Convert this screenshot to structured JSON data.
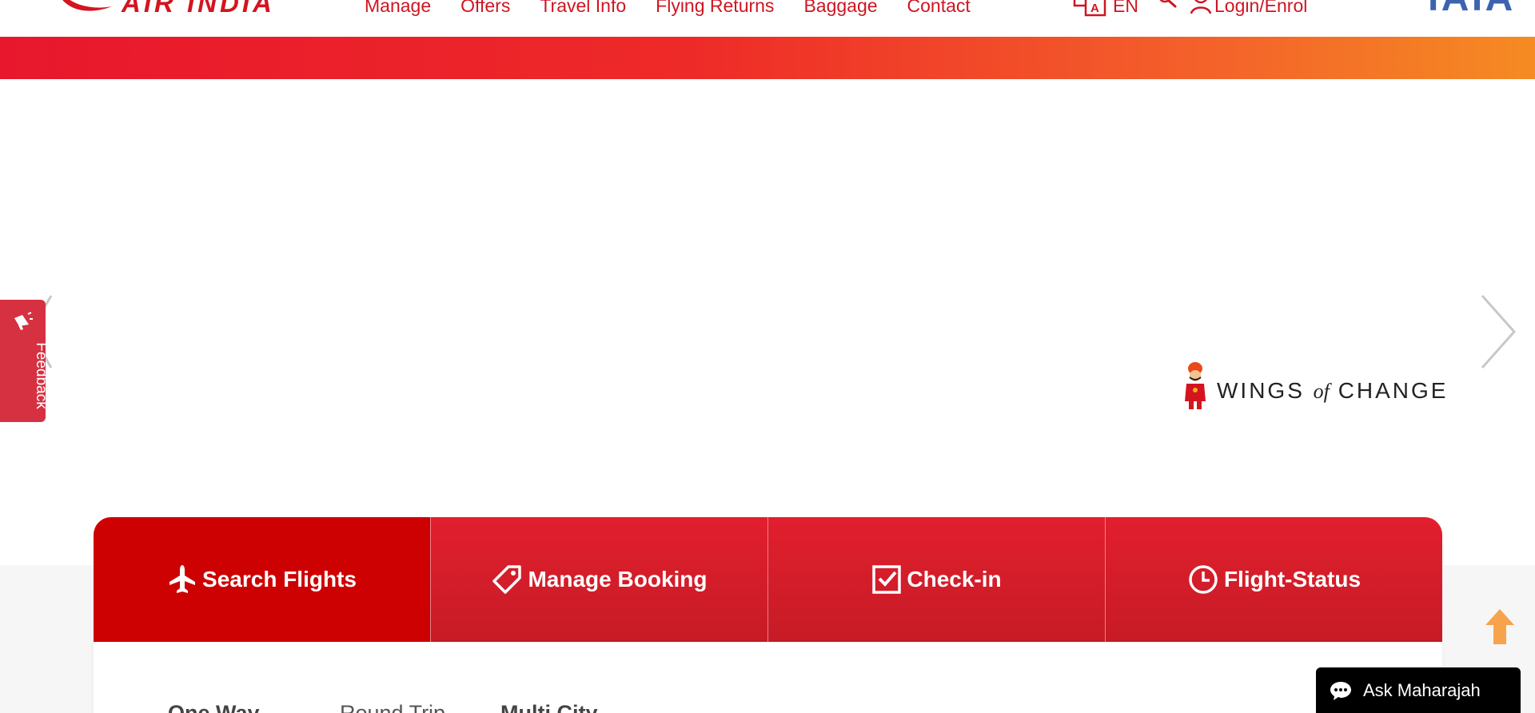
{
  "header": {
    "logo_text": "AIR INDIA",
    "nav": [
      "Manage",
      "Offers",
      "Travel Info",
      "Flying Returns",
      "Baggage",
      "Contact"
    ],
    "language": "EN",
    "login_label": "Login/Enrol",
    "partner_logo_text": "TATA"
  },
  "hero": {
    "campaign_words": [
      "WINGS",
      "of",
      "CHANGE"
    ]
  },
  "feedback": {
    "label": "Feedback"
  },
  "tabs": [
    {
      "label": "Search Flights",
      "icon": "airplane-icon",
      "active": true
    },
    {
      "label": "Manage Booking",
      "icon": "tag-icon",
      "active": false
    },
    {
      "label": "Check-in",
      "icon": "checkbox-icon",
      "active": false
    },
    {
      "label": "Flight-Status",
      "icon": "clock-icon",
      "active": false
    }
  ],
  "trip_types": [
    "One Way",
    "Round Trip",
    "Multi City"
  ],
  "chat": {
    "label": "Ask Maharajah"
  },
  "colors": {
    "brand_red": "#cd0002",
    "nav_red": "#cf1521",
    "gradient_start": "#e8172d",
    "gradient_end": "#f58b22",
    "feedback_red": "#d63141",
    "scroll_top_orange": "#f7a34b",
    "tata_blue": "#3d63b0"
  }
}
